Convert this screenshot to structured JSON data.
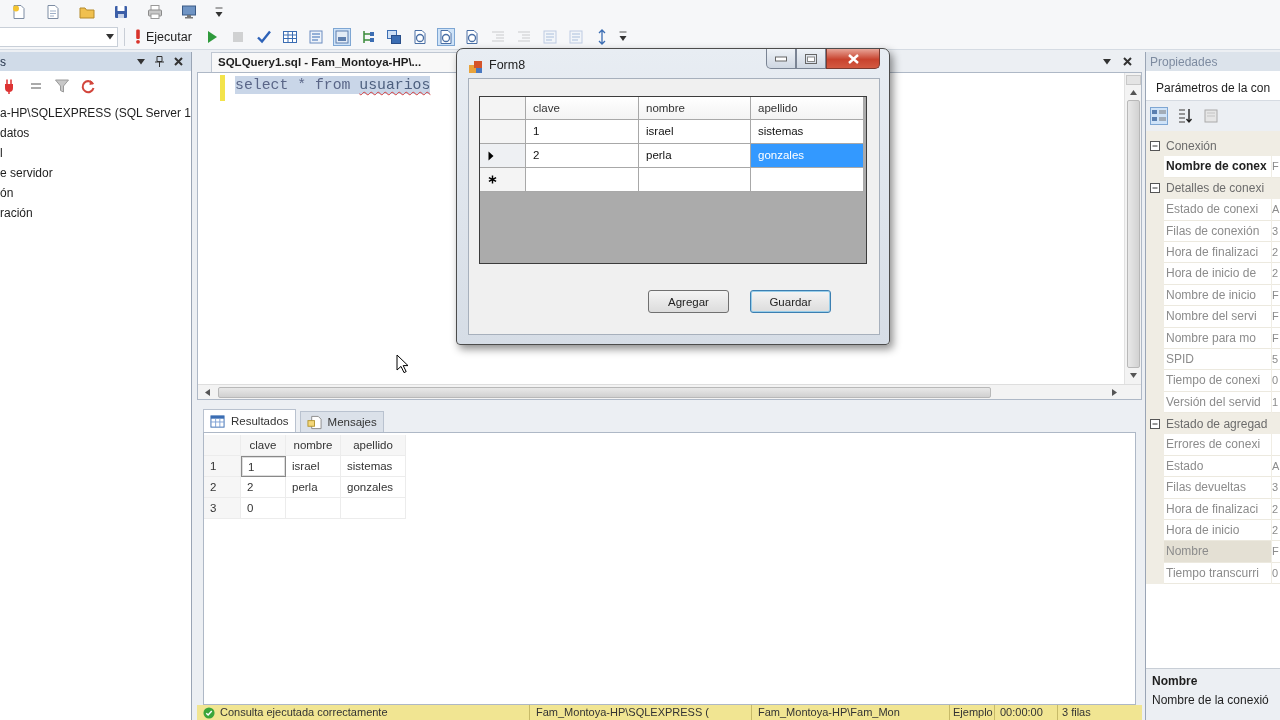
{
  "toolbar": {
    "buttons": [
      {
        "kind": "execute",
        "label": "Ejecutar",
        "pressed": false,
        "disabled": false
      },
      {
        "kind": "play",
        "pressed": false,
        "disabled": false
      },
      {
        "kind": "stop",
        "pressed": false,
        "disabled": true
      },
      {
        "kind": "check",
        "pressed": false,
        "disabled": false
      },
      {
        "kind": "table",
        "pressed": false,
        "disabled": false
      },
      {
        "kind": "lines",
        "pressed": false,
        "disabled": false
      },
      {
        "kind": "panel",
        "pressed": true,
        "disabled": false
      },
      {
        "kind": "branch",
        "pressed": false,
        "disabled": false
      },
      {
        "kind": "windows",
        "pressed": false,
        "disabled": false
      },
      {
        "kind": "page",
        "pressed": false,
        "disabled": false
      },
      {
        "kind": "page",
        "pressed": true,
        "disabled": false
      },
      {
        "kind": "page",
        "pressed": false,
        "disabled": false
      },
      {
        "kind": "indent",
        "pressed": false,
        "disabled": true
      },
      {
        "kind": "indent",
        "pressed": false,
        "disabled": true
      },
      {
        "kind": "lines",
        "pressed": false,
        "disabled": true
      },
      {
        "kind": "lines",
        "pressed": false,
        "disabled": true
      },
      {
        "kind": "font",
        "pressed": false,
        "disabled": false
      }
    ]
  },
  "object_explorer": {
    "title": "s",
    "items": [
      {
        "label": "a-HP\\SQLEXPRESS (SQL Server 1"
      },
      {
        "label": "datos"
      },
      {
        "label": "l"
      },
      {
        "label": "e servidor"
      },
      {
        "label": "ón"
      },
      {
        "label": "ración"
      }
    ]
  },
  "editor": {
    "tab": {
      "label": "SQLQuery1.sql - Fam_Montoya-HP\\..."
    },
    "lines": [
      {
        "modified": true,
        "selected": true,
        "tokens": [
          {
            "text": "select * from ",
            "error": false
          },
          {
            "text": "usuarios",
            "error": true
          }
        ]
      }
    ]
  },
  "form": {
    "title": "Form8",
    "grid": {
      "columns": [
        "clave",
        "nombre",
        "apellido"
      ],
      "rows": [
        {
          "kind": "data",
          "current": false,
          "cells": [
            {
              "text": "1",
              "selected": false
            },
            {
              "text": "israel",
              "selected": false
            },
            {
              "text": "sistemas",
              "selected": false
            }
          ]
        },
        {
          "kind": "data",
          "current": true,
          "cells": [
            {
              "text": "2",
              "selected": false
            },
            {
              "text": "perla",
              "selected": false
            },
            {
              "text": "gonzales",
              "selected": true
            }
          ]
        },
        {
          "kind": "new",
          "current": false
        }
      ]
    },
    "buttons": [
      {
        "label": "Agregar",
        "focused": false
      },
      {
        "label": "Guardar",
        "focused": true
      }
    ]
  },
  "results": {
    "tabs": [
      {
        "kind": "grid",
        "label": "Resultados",
        "selected": true
      },
      {
        "kind": "messages",
        "label": "Mensajes",
        "selected": false
      }
    ],
    "columns": [
      "clave",
      "nombre",
      "apellido"
    ],
    "rows": [
      {
        "number": "1",
        "cells": [
          {
            "text": "1",
            "focused": true
          },
          {
            "text": "israel",
            "focused": false
          },
          {
            "text": "sistemas",
            "focused": false
          }
        ]
      },
      {
        "number": "2",
        "cells": [
          {
            "text": "2",
            "focused": false
          },
          {
            "text": "perla",
            "focused": false
          },
          {
            "text": "gonzales",
            "focused": false
          }
        ]
      },
      {
        "number": "3",
        "cells": [
          {
            "text": "0",
            "focused": false
          },
          {
            "focused": false
          },
          {
            "focused": false
          }
        ]
      }
    ]
  },
  "status_bar": {
    "success": true,
    "message": "Consulta ejecutada correctamente",
    "fields": [
      "Fam_Montoya-HP\\SQLEXPRESS (",
      "Fam_Montoya-HP\\Fam_Mon",
      "Ejemplo",
      "00:00:00",
      "3 filas"
    ]
  },
  "properties": {
    "title": "Propiedades",
    "object": "Parámetros de la con",
    "view_buttons": [
      {
        "kind": "categorized",
        "selected": true
      },
      {
        "kind": "alphabetical",
        "selected": false
      },
      {
        "kind": "pages",
        "selected": false
      }
    ],
    "categories": [
      {
        "name": "Conexión",
        "expanded": true,
        "properties": [
          {
            "name": "Nombre de conex",
            "value": "F",
            "modified": true,
            "selected": false
          }
        ]
      },
      {
        "name": "Detalles de conexi",
        "expanded": true,
        "properties": [
          {
            "name": "Estado de conexi",
            "value": "A",
            "modified": false,
            "selected": false
          },
          {
            "name": "Filas de conexión",
            "value": "3",
            "modified": false,
            "selected": false
          },
          {
            "name": "Hora de finalizaci",
            "value": "2",
            "modified": false,
            "selected": false
          },
          {
            "name": "Hora de inicio de",
            "value": "2",
            "modified": false,
            "selected": false
          },
          {
            "name": "Nombre de inicio",
            "value": "F",
            "modified": false,
            "selected": false
          },
          {
            "name": "Nombre del servi",
            "value": "F",
            "modified": false,
            "selected": false
          },
          {
            "name": "Nombre para mo",
            "value": "F",
            "modified": false,
            "selected": false
          },
          {
            "name": "SPID",
            "value": "5",
            "modified": false,
            "selected": false
          },
          {
            "name": "Tiempo de conexi",
            "value": "0",
            "modified": false,
            "selected": false
          },
          {
            "name": "Versión del servid",
            "value": "1",
            "modified": false,
            "selected": false
          }
        ]
      },
      {
        "name": "Estado de agregad",
        "expanded": true,
        "properties": [
          {
            "name": "Errores de conexi",
            "modified": false,
            "selected": false
          },
          {
            "name": "Estado",
            "value": "A",
            "modified": false,
            "selected": false
          },
          {
            "name": "Filas devueltas",
            "value": "3",
            "modified": false,
            "selected": false
          },
          {
            "name": "Hora de finalizaci",
            "value": "2",
            "modified": false,
            "selected": false
          },
          {
            "name": "Hora de inicio",
            "value": "2",
            "modified": false,
            "selected": false
          },
          {
            "name": "Nombre",
            "value": "F",
            "modified": false,
            "selected": true
          },
          {
            "name": "Tiempo transcurri",
            "value": "0",
            "modified": false,
            "selected": false
          }
        ]
      }
    ],
    "description": {
      "title": "Nombre",
      "text": "Nombre de la conexió"
    }
  }
}
